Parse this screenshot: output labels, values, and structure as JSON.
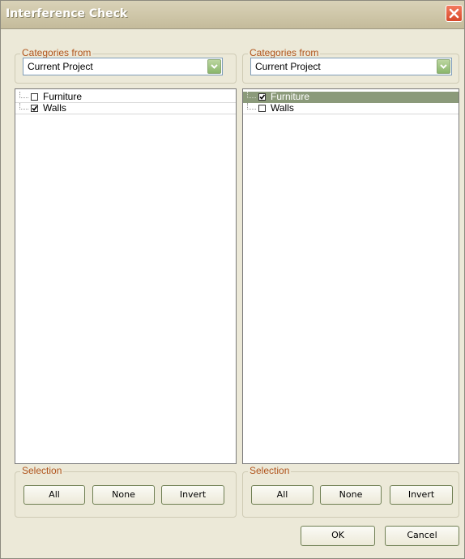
{
  "window": {
    "title": "Interference Check"
  },
  "left_panel": {
    "categories_label": "Categories from",
    "categories_value": "Current Project",
    "items": [
      {
        "label": "Furniture",
        "checked": false,
        "selected": false
      },
      {
        "label": "Walls",
        "checked": true,
        "selected": false
      }
    ],
    "selection_label": "Selection",
    "buttons": {
      "all": "All",
      "none": "None",
      "invert": "Invert"
    }
  },
  "right_panel": {
    "categories_label": "Categories from",
    "categories_value": "Current Project",
    "items": [
      {
        "label": "Furniture",
        "checked": true,
        "selected": true
      },
      {
        "label": "Walls",
        "checked": false,
        "selected": false
      }
    ],
    "selection_label": "Selection",
    "buttons": {
      "all": "All",
      "none": "None",
      "invert": "Invert"
    }
  },
  "footer": {
    "ok": "OK",
    "cancel": "Cancel"
  },
  "colors": {
    "group_label": "#b0541c",
    "selected_row": "#8b9a7a",
    "dropdown_arrow": "#8ab66c"
  }
}
